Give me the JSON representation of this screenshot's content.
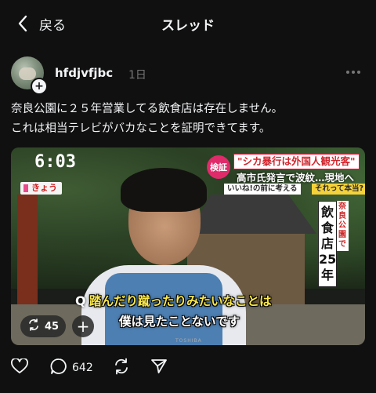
{
  "nav": {
    "back_label": "戻る",
    "title": "スレッド"
  },
  "post": {
    "username": "hfdjvfjbc",
    "time": "1日",
    "text_lines": [
      "奈良公園に２５年営業してる飲食店は存在しません。",
      "これは相当テレビがバカなことを証明できてます。"
    ],
    "media": {
      "tv_time": "6:03",
      "tv_tag": "きょう",
      "headline_badge": "検証",
      "headline_main": "\"シカ暴行は外国人観光客\"",
      "headline_sub": "高市氏発言で波紋…現地へ",
      "headline_strip": "いいね!の前に考える",
      "headline_strip2": "それって本当?",
      "vertical_label_small": "奈良公園で",
      "vertical_label_large": "飲食店25年",
      "subtitle_q": "Q",
      "subtitle_line1": "踏んだり蹴ったりみたいなことは",
      "subtitle_line2": "僕は見たことないです",
      "tv_brand": "TOSHIBA",
      "repost_count": "45"
    },
    "actions": {
      "like_count": "",
      "comment_count": "642",
      "repost_count": "",
      "share_count": ""
    }
  },
  "colors": {
    "background": "#101010",
    "text_primary": "#f3f5f7",
    "text_secondary": "#777777"
  }
}
